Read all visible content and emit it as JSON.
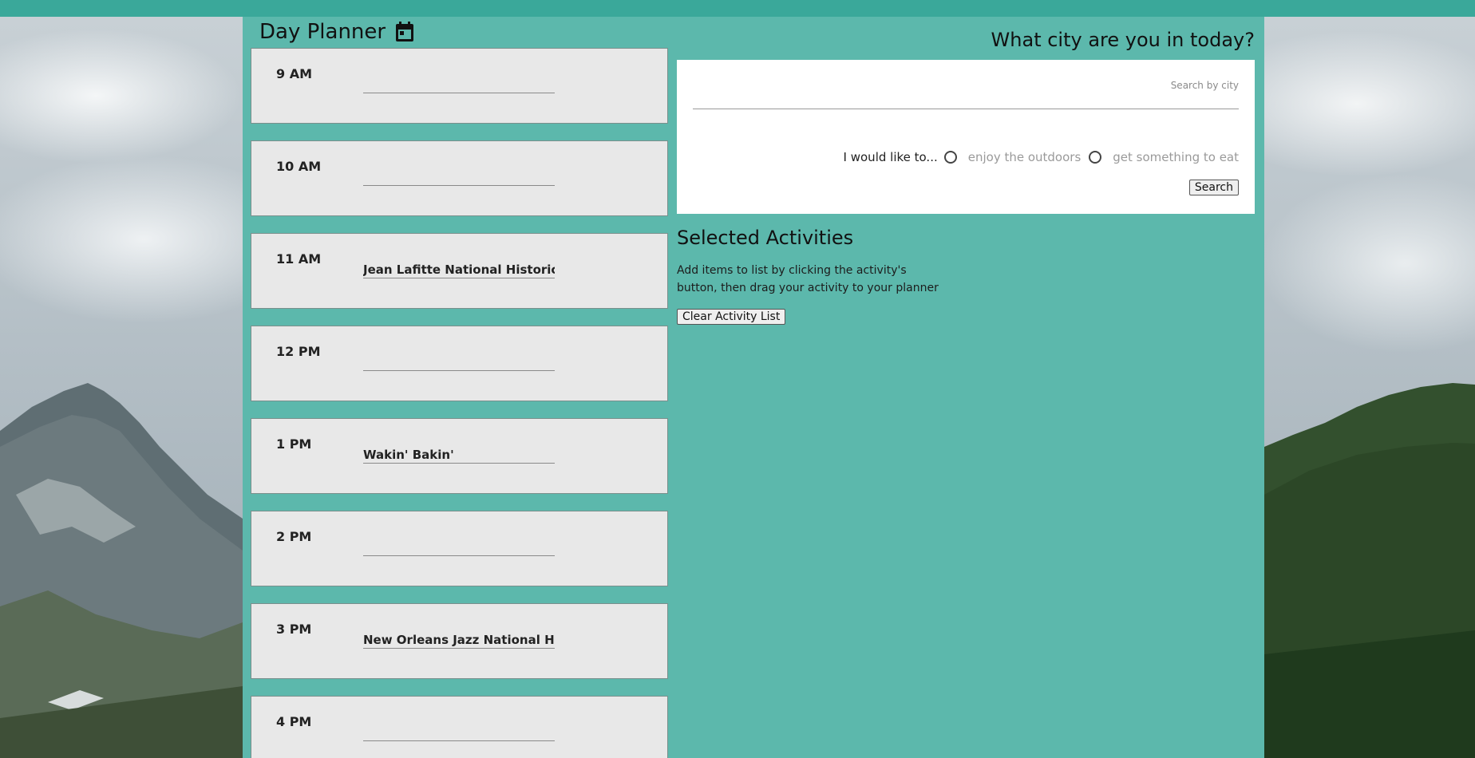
{
  "app": {
    "title": "Day Planner",
    "calendar_icon": "calendar-icon"
  },
  "colors": {
    "topbar": "#3aa89a",
    "main_bg": "#5cb8ac",
    "slot_bg": "#e8e8e8"
  },
  "planner": {
    "hours": [
      {
        "label": "9 AM",
        "activity": ""
      },
      {
        "label": "10 AM",
        "activity": ""
      },
      {
        "label": "11 AM",
        "activity": "Jean Lafitte National Historical Park"
      },
      {
        "label": "12 PM",
        "activity": ""
      },
      {
        "label": "1 PM",
        "activity": "Wakin' Bakin'"
      },
      {
        "label": "2 PM",
        "activity": ""
      },
      {
        "label": "3 PM",
        "activity": "New Orleans Jazz National Historical Park"
      },
      {
        "label": "4 PM",
        "activity": ""
      }
    ]
  },
  "search": {
    "heading": "What city are you in today?",
    "placeholder": "Search by city",
    "value": "",
    "intro": "I would like to...",
    "options": [
      "enjoy the outdoors",
      "get something to eat"
    ],
    "button": "Search"
  },
  "selected": {
    "title": "Selected Activities",
    "description": "Add items to list by clicking the activity's button, then drag your activity to your planner",
    "clear_button": "Clear Activity List"
  }
}
